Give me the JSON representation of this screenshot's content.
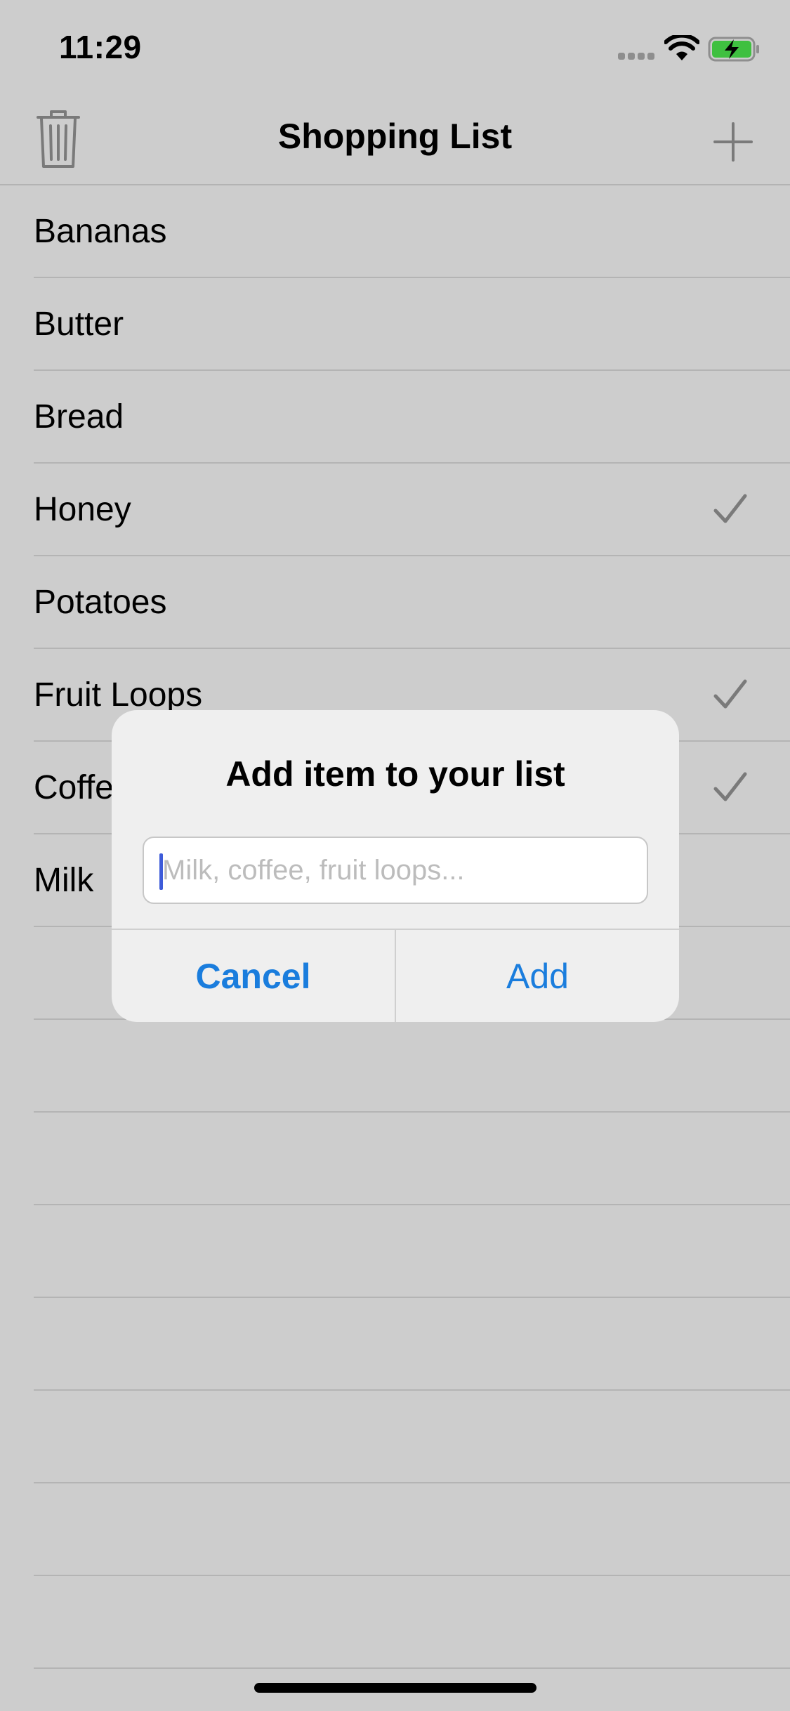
{
  "status_bar": {
    "time": "11:29",
    "icons": [
      "signal-icon",
      "wifi-icon",
      "battery-charging-icon"
    ],
    "battery_color": "#3fc040"
  },
  "nav": {
    "title": "Shopping List",
    "left_icon": "trash-icon",
    "right_icon": "plus-icon"
  },
  "items": [
    {
      "label": "Bananas",
      "checked": false
    },
    {
      "label": "Butter",
      "checked": false
    },
    {
      "label": "Bread",
      "checked": false
    },
    {
      "label": "Honey",
      "checked": true
    },
    {
      "label": "Potatoes",
      "checked": false
    },
    {
      "label": "Fruit Loops",
      "checked": true
    },
    {
      "label": "Coffee",
      "checked": true
    },
    {
      "label": "Milk",
      "checked": false
    }
  ],
  "alert": {
    "title": "Add item to your list",
    "input_value": "",
    "placeholder": "Milk, coffee, fruit loops...",
    "cancel_label": "Cancel",
    "confirm_label": "Add",
    "button_color": "#1a7ddd"
  },
  "colors": {
    "dimmed_background": "#cdcdcd",
    "separator": "#b4b4b4",
    "icon_gray": "#7a7a7a"
  }
}
